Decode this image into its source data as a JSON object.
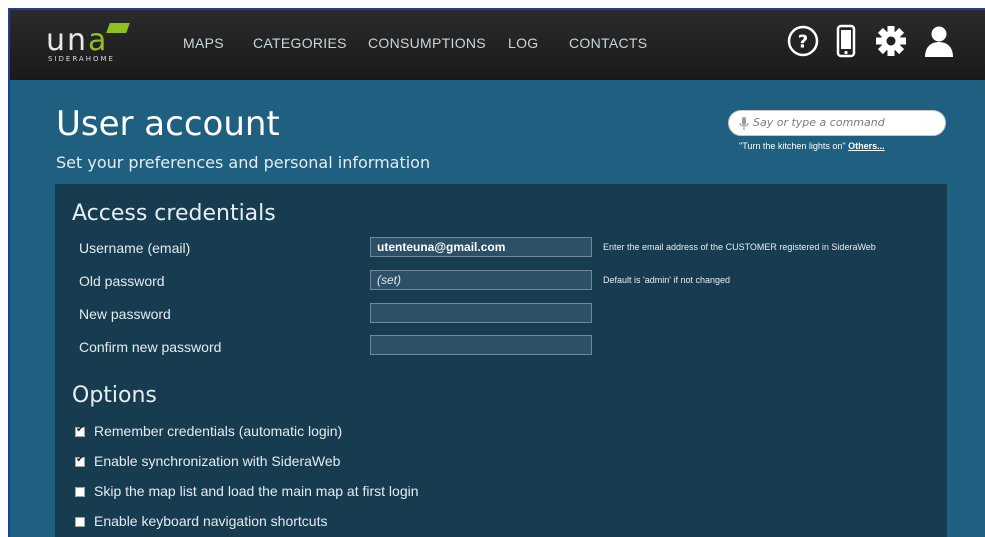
{
  "brand": {
    "logo_word_white": "un",
    "logo_word_green": "a",
    "logo_subtitle": "SIDERAHOME"
  },
  "nav": {
    "items": [
      "MAPS",
      "CATEGORIES",
      "CONSUMPTIONS",
      "LOG",
      "CONTACTS"
    ],
    "icons": [
      "help-icon",
      "mobile-icon",
      "gear-icon",
      "user-icon"
    ]
  },
  "page": {
    "title": "User account",
    "subtitle": "Set your preferences and personal information"
  },
  "command": {
    "placeholder": "Say or type a command",
    "hint_prefix": "\"Turn the kitchen lights on\"",
    "hint_link": "Others..."
  },
  "credentials": {
    "title": "Access credentials",
    "username_label": "Username (email)",
    "username_value": "utenteuna@gmail.com",
    "username_hint": "Enter the email address of the CUSTOMER registered in SideraWeb",
    "old_password_label": "Old password",
    "old_password_value": "(set)",
    "old_password_hint": "Default is 'admin' if not changed",
    "new_password_label": "New password",
    "new_password_value": "",
    "confirm_password_label": "Confirm new password",
    "confirm_password_value": ""
  },
  "options": {
    "title": "Options",
    "items": [
      {
        "label": "Remember credentials (automatic login)",
        "checked": true
      },
      {
        "label": "Enable synchronization with SideraWeb",
        "checked": true
      },
      {
        "label": "Skip the map list and load the main map at first login",
        "checked": false
      },
      {
        "label": "Enable keyboard navigation shortcuts",
        "checked": false
      }
    ]
  },
  "colors": {
    "background": "#1f5f7f",
    "panel": "#173c50",
    "navbar": "#1f1f1f",
    "brand_green": "#8ec11f"
  }
}
